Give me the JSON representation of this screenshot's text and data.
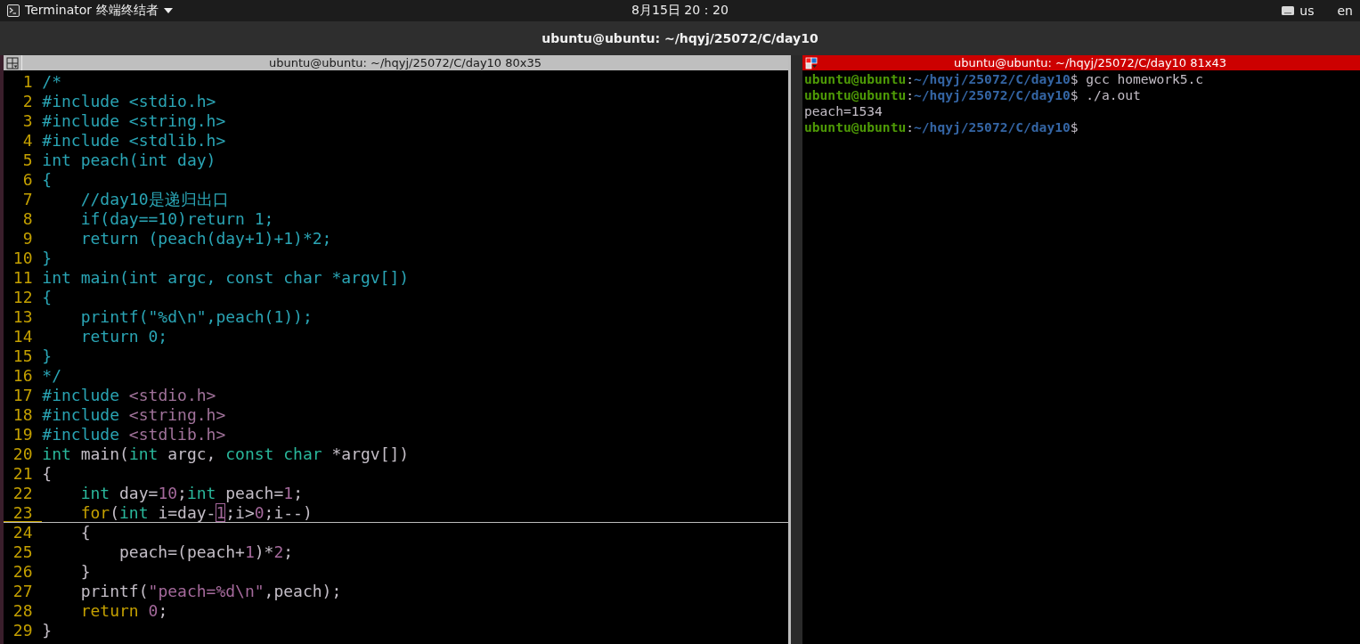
{
  "top_bar": {
    "app_menu": "Terminator 终端终结者",
    "clock": "8月15日 20：20",
    "keyboard_layout": "us",
    "language": "en"
  },
  "window": {
    "title": "ubuntu@ubuntu: ~/hqyj/25072/C/day10"
  },
  "panes": [
    {
      "kind": "editor",
      "title": "ubuntu@ubuntu: ~/hqyj/25072/C/day10 80x35",
      "focused": false,
      "lines": [
        {
          "number": "1",
          "current": false,
          "tokens": [
            {
              "kind": "comment",
              "text": "/*"
            }
          ]
        },
        {
          "number": "2",
          "current": false,
          "tokens": [
            {
              "kind": "comment",
              "text": "#include <stdio.h>"
            }
          ]
        },
        {
          "number": "3",
          "current": false,
          "tokens": [
            {
              "kind": "comment",
              "text": "#include <string.h>"
            }
          ]
        },
        {
          "number": "4",
          "current": false,
          "tokens": [
            {
              "kind": "comment",
              "text": "#include <stdlib.h>"
            }
          ]
        },
        {
          "number": "5",
          "current": false,
          "tokens": [
            {
              "kind": "comment",
              "text": "int peach(int day)"
            }
          ]
        },
        {
          "number": "6",
          "current": false,
          "tokens": [
            {
              "kind": "comment",
              "text": "{"
            }
          ]
        },
        {
          "number": "7",
          "current": false,
          "tokens": [
            {
              "kind": "comment",
              "text": "    //day10是递归出口"
            }
          ]
        },
        {
          "number": "8",
          "current": false,
          "tokens": [
            {
              "kind": "comment",
              "text": "    if(day==10)return 1;"
            }
          ]
        },
        {
          "number": "9",
          "current": false,
          "tokens": [
            {
              "kind": "comment",
              "text": "    return (peach(day+1)+1)*2;"
            }
          ]
        },
        {
          "number": "10",
          "current": false,
          "tokens": [
            {
              "kind": "comment",
              "text": "}"
            }
          ]
        },
        {
          "number": "11",
          "current": false,
          "tokens": [
            {
              "kind": "comment",
              "text": "int main(int argc, const char *argv[])"
            }
          ]
        },
        {
          "number": "12",
          "current": false,
          "tokens": [
            {
              "kind": "comment",
              "text": "{"
            }
          ]
        },
        {
          "number": "13",
          "current": false,
          "tokens": [
            {
              "kind": "comment",
              "text": "    printf(\"%d\\n\",peach(1));"
            }
          ]
        },
        {
          "number": "14",
          "current": false,
          "tokens": [
            {
              "kind": "comment",
              "text": "    return 0;"
            }
          ]
        },
        {
          "number": "15",
          "current": false,
          "tokens": [
            {
              "kind": "comment",
              "text": "}"
            }
          ]
        },
        {
          "number": "16",
          "current": false,
          "tokens": [
            {
              "kind": "comment",
              "text": "*/"
            }
          ]
        },
        {
          "number": "17",
          "current": false,
          "tokens": [
            {
              "kind": "preproc",
              "text": "#include"
            },
            {
              "kind": "header",
              "text": " <stdio.h>"
            }
          ]
        },
        {
          "number": "18",
          "current": false,
          "tokens": [
            {
              "kind": "preproc",
              "text": "#include"
            },
            {
              "kind": "header",
              "text": " <string.h>"
            }
          ]
        },
        {
          "number": "19",
          "current": false,
          "tokens": [
            {
              "kind": "preproc",
              "text": "#include"
            },
            {
              "kind": "header",
              "text": " <stdlib.h>"
            }
          ]
        },
        {
          "number": "20",
          "current": false,
          "tokens": [
            {
              "kind": "type",
              "text": "int"
            },
            {
              "kind": "plain",
              "text": " main("
            },
            {
              "kind": "type",
              "text": "int"
            },
            {
              "kind": "plain",
              "text": " argc, "
            },
            {
              "kind": "type",
              "text": "const char"
            },
            {
              "kind": "plain",
              "text": " *argv[])"
            }
          ]
        },
        {
          "number": "21",
          "current": false,
          "tokens": [
            {
              "kind": "plain",
              "text": "{"
            }
          ]
        },
        {
          "number": "22",
          "current": false,
          "tokens": [
            {
              "kind": "type",
              "text": "    int"
            },
            {
              "kind": "plain",
              "text": " day="
            },
            {
              "kind": "number",
              "text": "10"
            },
            {
              "kind": "plain",
              "text": ";"
            },
            {
              "kind": "type",
              "text": "int"
            },
            {
              "kind": "plain",
              "text": " peach="
            },
            {
              "kind": "number",
              "text": "1"
            },
            {
              "kind": "plain",
              "text": ";"
            }
          ]
        },
        {
          "number": "23",
          "current": true,
          "tokens": [
            {
              "kind": "keyword",
              "text": "    for"
            },
            {
              "kind": "plain",
              "text": "("
            },
            {
              "kind": "type",
              "text": "int"
            },
            {
              "kind": "plain",
              "text": " i=day-"
            },
            {
              "kind": "cursor",
              "text": "1"
            },
            {
              "kind": "plain",
              "text": ";i>"
            },
            {
              "kind": "number",
              "text": "0"
            },
            {
              "kind": "plain",
              "text": ";i--)"
            }
          ]
        },
        {
          "number": "24",
          "current": false,
          "tokens": [
            {
              "kind": "plain",
              "text": "    {"
            }
          ]
        },
        {
          "number": "25",
          "current": false,
          "tokens": [
            {
              "kind": "plain",
              "text": "        peach=(peach+"
            },
            {
              "kind": "number",
              "text": "1"
            },
            {
              "kind": "plain",
              "text": ")*"
            },
            {
              "kind": "number",
              "text": "2"
            },
            {
              "kind": "plain",
              "text": ";"
            }
          ]
        },
        {
          "number": "26",
          "current": false,
          "tokens": [
            {
              "kind": "plain",
              "text": "    }"
            }
          ]
        },
        {
          "number": "27",
          "current": false,
          "tokens": [
            {
              "kind": "plain",
              "text": "    printf("
            },
            {
              "kind": "string",
              "text": "\"peach=%d\\n\""
            },
            {
              "kind": "plain",
              "text": ",peach);"
            }
          ]
        },
        {
          "number": "28",
          "current": false,
          "tokens": [
            {
              "kind": "keyword",
              "text": "    return"
            },
            {
              "kind": "number",
              "text": " 0"
            },
            {
              "kind": "plain",
              "text": ";"
            }
          ]
        },
        {
          "number": "29",
          "current": false,
          "tokens": [
            {
              "kind": "plain",
              "text": "}"
            }
          ]
        }
      ]
    },
    {
      "kind": "shell",
      "title": "ubuntu@ubuntu: ~/hqyj/25072/C/day10 81x43",
      "focused": true,
      "lines": [
        {
          "tokens": [
            {
              "kind": "user",
              "text": "ubuntu@ubuntu"
            },
            {
              "kind": "plain",
              "text": ":"
            },
            {
              "kind": "path",
              "text": "~/hqyj/25072/C/day10"
            },
            {
              "kind": "plain",
              "text": "$ gcc homework5.c"
            }
          ]
        },
        {
          "tokens": [
            {
              "kind": "user",
              "text": "ubuntu@ubuntu"
            },
            {
              "kind": "plain",
              "text": ":"
            },
            {
              "kind": "path",
              "text": "~/hqyj/25072/C/day10"
            },
            {
              "kind": "plain",
              "text": "$ ./a.out"
            }
          ]
        },
        {
          "tokens": [
            {
              "kind": "plain",
              "text": "peach=1534"
            }
          ]
        },
        {
          "tokens": [
            {
              "kind": "user",
              "text": "ubuntu@ubuntu"
            },
            {
              "kind": "plain",
              "text": ":"
            },
            {
              "kind": "path",
              "text": "~/hqyj/25072/C/day10"
            },
            {
              "kind": "plain",
              "text": "$"
            }
          ]
        }
      ]
    }
  ]
}
